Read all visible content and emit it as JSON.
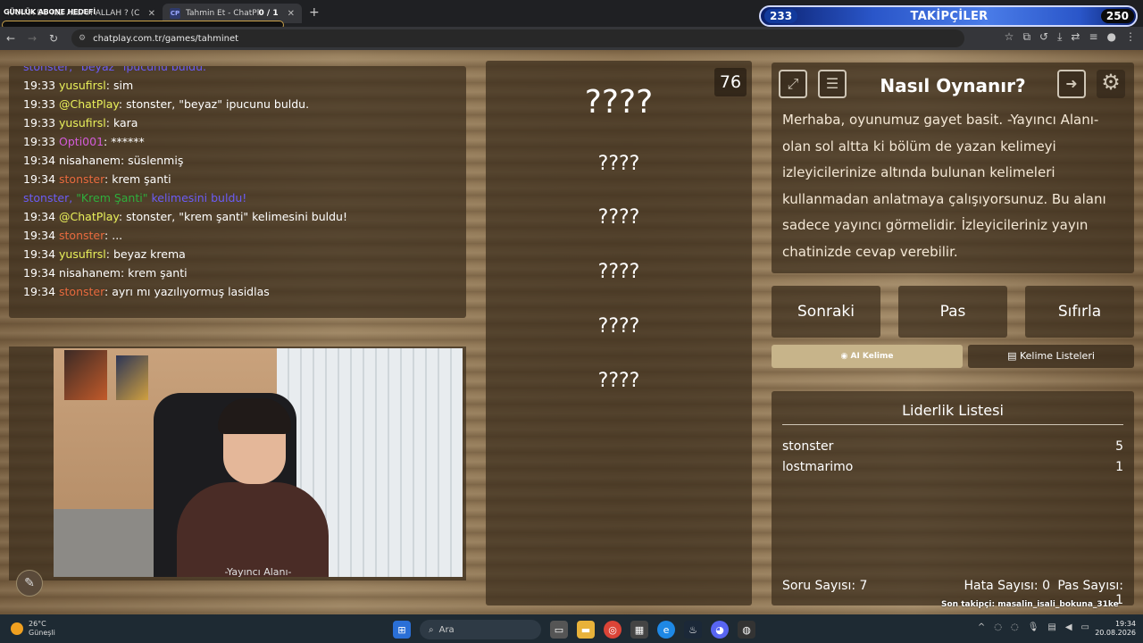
{
  "browser": {
    "tabs": [
      {
        "title": "KANKA BU KIZ ALLAH ALLAH ? (C",
        "overlay": "GÜNLÜK ABONE HEDEFİ"
      },
      {
        "favicon": "CP",
        "title": "Tahmin Et - ChatPlay",
        "counter": "0 / 1"
      }
    ],
    "url": "chatplay.com.tr/games/tahminet"
  },
  "followers_widget": {
    "current": "233",
    "label": "TAKİPÇİLER",
    "goal": "250"
  },
  "chat": {
    "lines": [
      {
        "time": "",
        "user": "stonster,",
        "user_color": "#6b5cf5",
        "msg": " \"beyaz\" ipucunu buldu.",
        "partial": true
      },
      {
        "time": "19:33",
        "user": "yusufirsl",
        "user_color": "#e9f05a",
        "msg": ": sim"
      },
      {
        "time": "19:33",
        "user": "@ChatPlay",
        "user_color": "#e9f05a",
        "msg": ": stonster, \"beyaz\" ipucunu buldu."
      },
      {
        "time": "19:33",
        "user": "yusufirsl",
        "user_color": "#e9f05a",
        "msg": ": kara"
      },
      {
        "time": "19:33",
        "user": "Opti001",
        "user_color": "#d35bd9",
        "msg": ": ******"
      },
      {
        "time": "19:34",
        "user": "nisahanem",
        "user_color": "#ffffff",
        "msg": ": süslenmiş"
      },
      {
        "time": "19:34",
        "user": "stonster",
        "user_color": "#e86a3e",
        "msg": ": krem şanti"
      },
      {
        "time": "",
        "user": "stonster,",
        "user_color": "#6b5cf5",
        "msg": " \"Krem Şanti\" kelimesini buldu!",
        "highlight": "\"Krem Şanti\""
      },
      {
        "time": "19:34",
        "user": "@ChatPlay",
        "user_color": "#e9f05a",
        "msg": ": stonster, \"krem şanti\" kelimesini buldu!"
      },
      {
        "time": "19:34",
        "user": "stonster",
        "user_color": "#e86a3e",
        "msg": ": ..."
      },
      {
        "time": "19:34",
        "user": "yusufirsl",
        "user_color": "#e9f05a",
        "msg": ": beyaz krema"
      },
      {
        "time": "19:34",
        "user": "nisahanem",
        "user_color": "#ffffff",
        "msg": ": krem şanti"
      },
      {
        "time": "19:34",
        "user": "stonster",
        "user_color": "#e86a3e",
        "msg": ": ayrı mı yazılıyormuş lasidlas"
      }
    ]
  },
  "webcam": {
    "label": "-Yayıncı Alanı-"
  },
  "game": {
    "timer": "76",
    "words": [
      "????",
      "????",
      "????",
      "????",
      "????",
      "????"
    ]
  },
  "howto": {
    "title": "Nasıl Oynanır?",
    "text": "Merhaba, oyunumuz gayet basit. -Yayıncı Alanı- olan sol altta ki bölüm de yazan kelimeyi izleyicilerinize altında bulunan kelimeleri kullanmadan anlatmaya çalışıyorsunuz. Bu alanı sadece yayıncı görmelidir. İzleyicileriniz yayın chatinizde cevap verebilir.",
    "icons": [
      "fullscreen-icon",
      "notes-icon",
      "exit-icon",
      "gear-icon"
    ]
  },
  "actions": {
    "next": "Sonraki",
    "pass": "Pas",
    "reset": "Sıfırla",
    "ai_word": "AI Kelime",
    "word_lists": "Kelime Listeleri"
  },
  "leaderboard": {
    "title": "Liderlik Listesi",
    "rows": [
      {
        "name": "stonster",
        "score": "5"
      },
      {
        "name": "lostmarimo",
        "score": "1"
      }
    ],
    "stats": {
      "questions": "Soru Sayısı: 7",
      "errors": "Hata Sayısı: 0",
      "passes": "Pas Sayısı: 1"
    }
  },
  "last_follower": "Son takipçi: masalin_isali_bokuna_31ke",
  "taskbar": {
    "weather_temp": "26°C",
    "weather_desc": "Güneşli",
    "search": "Ara",
    "time": "19:34",
    "date": "20.08.2026"
  }
}
